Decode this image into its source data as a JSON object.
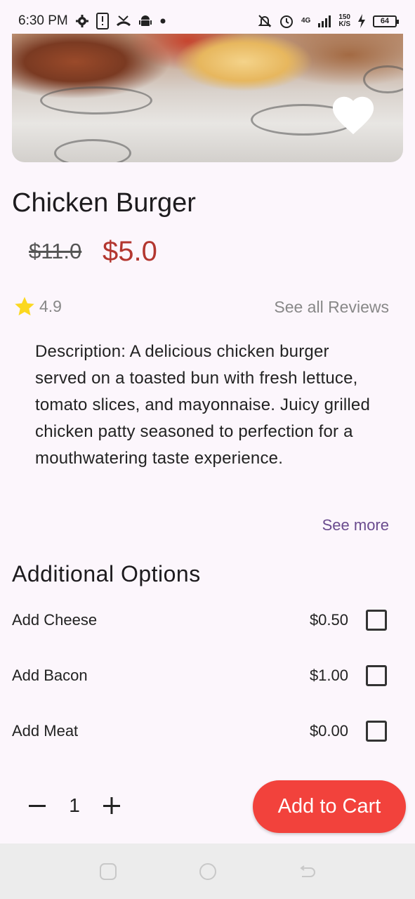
{
  "status_bar": {
    "time": "6:30 PM",
    "network": "4G",
    "speed_top": "150",
    "speed_bottom": "K/S",
    "battery": "64",
    "icons": [
      "gear-icon",
      "sim-alert-icon",
      "missed-call-icon",
      "android-icon",
      "dot-icon",
      "bell-off-icon",
      "alarm-icon",
      "signal-icon",
      "charging-icon",
      "battery-icon"
    ]
  },
  "hero": {
    "image": "chicken-burger-photo",
    "favorite_icon": "heart-icon"
  },
  "product": {
    "title": "Chicken Burger",
    "old_price": "$11.0",
    "new_price": "$5.0",
    "rating": "4.9",
    "reviews_link": "See all Reviews",
    "description": "Description: A delicious chicken burger served on a toasted bun with fresh lettuce, tomato slices, and mayonnaise. Juicy grilled chicken patty seasoned to perfection for a mouthwatering taste experience.",
    "see_more": "See more"
  },
  "options": {
    "title": "Additional Options",
    "items": [
      {
        "label": "Add Cheese",
        "price": "$0.50",
        "checked": false
      },
      {
        "label": "Add Bacon",
        "price": "$1.00",
        "checked": false
      },
      {
        "label": "Add Meat",
        "price": "$0.00",
        "checked": false
      }
    ]
  },
  "cart": {
    "quantity": "1",
    "button_label": "Add to Cart"
  },
  "colors": {
    "accent": "#f2423c",
    "price": "#b3362f",
    "link": "#6a4b8e",
    "background": "#fcf6fc"
  }
}
